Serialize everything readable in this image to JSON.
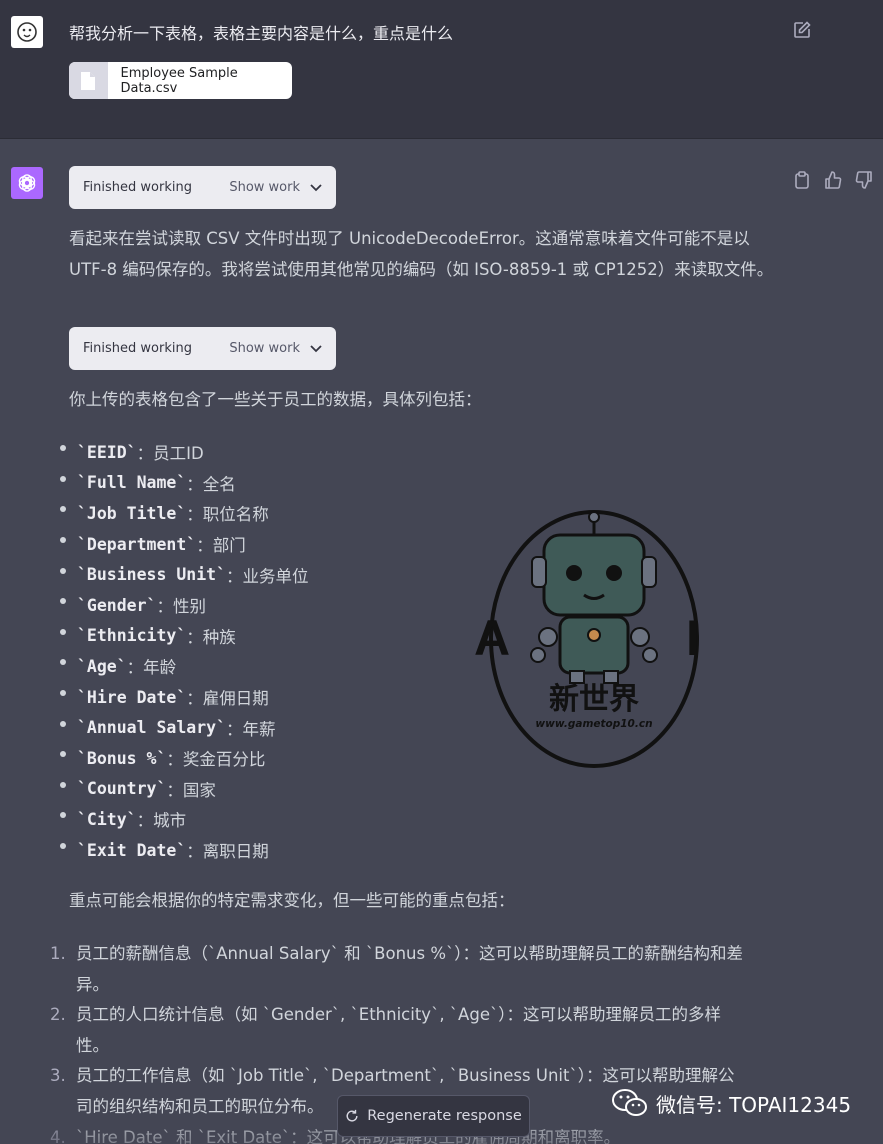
{
  "user": {
    "message": "帮我分析一下表格，表格主要内容是什么，重点是什么",
    "file_name": "Employee Sample Data.csv"
  },
  "work_pills": [
    {
      "status": "Finished working",
      "toggle": "Show work"
    },
    {
      "status": "Finished working",
      "toggle": "Show work"
    }
  ],
  "response": {
    "intro": "看起来在尝试读取 CSV 文件时出现了 UnicodeDecodeError。这通常意味着文件可能不是以 UTF-8 编码保存的。我将尝试使用其他常见的编码（如 ISO-8859-1 或 CP1252）来读取文件。",
    "columns_intro": "你上传的表格包含了一些关于员工的数据，具体列包括：",
    "columns": [
      {
        "code": "`EEID`",
        "desc": "：员工ID"
      },
      {
        "code": "`Full Name`",
        "desc": "：全名"
      },
      {
        "code": "`Job Title`",
        "desc": "：职位名称"
      },
      {
        "code": "`Department`",
        "desc": "：部门"
      },
      {
        "code": "`Business Unit`",
        "desc": "：业务单位"
      },
      {
        "code": "`Gender`",
        "desc": "：性别"
      },
      {
        "code": "`Ethnicity`",
        "desc": "：种族"
      },
      {
        "code": "`Age`",
        "desc": "：年龄"
      },
      {
        "code": "`Hire Date`",
        "desc": "：雇佣日期"
      },
      {
        "code": "`Annual Salary`",
        "desc": "：年薪"
      },
      {
        "code": "`Bonus %`",
        "desc": "：奖金百分比"
      },
      {
        "code": "`Country`",
        "desc": "：国家"
      },
      {
        "code": "`City`",
        "desc": "：城市"
      },
      {
        "code": "`Exit Date`",
        "desc": "：离职日期"
      }
    ],
    "focus_intro": "重点可能会根据你的特定需求变化，但一些可能的重点包括：",
    "focus": [
      {
        "num": "1.",
        "line1": "员工的薪酬信息（`Annual Salary` 和 `Bonus %`）：这可以帮助理解员工的薪酬结构和差",
        "line2": "异。"
      },
      {
        "num": "2.",
        "line1": "员工的人口统计信息（如 `Gender`, `Ethnicity`, `Age`）：这可以帮助理解员工的多样",
        "line2": "性。"
      },
      {
        "num": "3.",
        "line1": "员工的工作信息（如 `Job Title`, `Department`, `Business Unit`）：这可以帮助理解公",
        "line2": "司的组织结构和员工的职位分布。"
      },
      {
        "num": "4.",
        "line1": "`Hire Date` 和 `Exit Date`：这可以帮助理解员工的雇佣周期和离职率。",
        "line2": ""
      }
    ]
  },
  "regenerate_label": "Regenerate response",
  "watermark": {
    "letter_left": "A",
    "letter_right": "I",
    "title": "新世界",
    "url": "www.gametop10.cn"
  },
  "wechat_label": "微信号: TOPAI12345"
}
